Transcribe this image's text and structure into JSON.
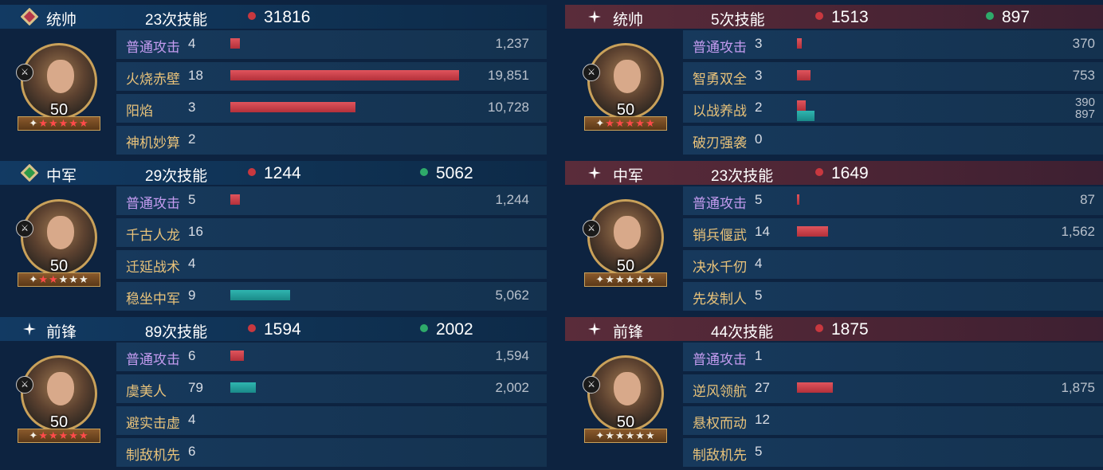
{
  "left": {
    "blocks": [
      {
        "role": "统帅",
        "casts": "23次技能",
        "stats": [
          {
            "color": "red",
            "value": "31816"
          }
        ],
        "level": "50",
        "stars_on": 5,
        "unit_icon": "spear-icon",
        "rows": [
          {
            "skill": "普通攻击",
            "basic": true,
            "count": "4",
            "red": 0.04,
            "teal": 0,
            "dmg": "1,237"
          },
          {
            "skill": "火烧赤壁",
            "basic": false,
            "count": "18",
            "red": 0.99,
            "teal": 0,
            "dmg": "19,851"
          },
          {
            "skill": "阳焰",
            "basic": false,
            "count": "3",
            "red": 0.54,
            "teal": 0,
            "dmg": "10,728"
          },
          {
            "skill": "神机妙算",
            "basic": false,
            "count": "2",
            "red": 0,
            "teal": 0,
            "dmg": ""
          }
        ]
      },
      {
        "role": "中军",
        "casts": "29次技能",
        "stats": [
          {
            "color": "red",
            "value": "1244"
          },
          {
            "color": "green",
            "value": "5062"
          }
        ],
        "level": "50",
        "stars_on": 2,
        "unit_icon": "cavalry-icon",
        "rows": [
          {
            "skill": "普通攻击",
            "basic": true,
            "count": "5",
            "red": 0.04,
            "teal": 0,
            "dmg": "1,244"
          },
          {
            "skill": "千古人龙",
            "basic": false,
            "count": "16",
            "red": 0,
            "teal": 0,
            "dmg": ""
          },
          {
            "skill": "迁延战术",
            "basic": false,
            "count": "4",
            "red": 0,
            "teal": 0,
            "dmg": ""
          },
          {
            "skill": "稳坐中军",
            "basic": false,
            "count": "9",
            "red": 0,
            "teal": 0.26,
            "dmg": "5,062"
          }
        ]
      },
      {
        "role": "前锋",
        "casts": "89次技能",
        "stats": [
          {
            "color": "red",
            "value": "1594"
          },
          {
            "color": "green",
            "value": "2002"
          }
        ],
        "level": "50",
        "stars_on": 5,
        "unit_icon": "horse-icon",
        "rows": [
          {
            "skill": "普通攻击",
            "basic": true,
            "count": "6",
            "red": 0.06,
            "teal": 0,
            "dmg": "1,594"
          },
          {
            "skill": "虞美人",
            "basic": false,
            "count": "79",
            "red": 0,
            "teal": 0.11,
            "dmg": "2,002"
          },
          {
            "skill": "避实击虚",
            "basic": false,
            "count": "4",
            "red": 0,
            "teal": 0,
            "dmg": ""
          },
          {
            "skill": "制敌机先",
            "basic": false,
            "count": "6",
            "red": 0,
            "teal": 0,
            "dmg": ""
          }
        ]
      }
    ]
  },
  "right": {
    "blocks": [
      {
        "role": "统帅",
        "casts": "5次技能",
        "stats": [
          {
            "color": "red",
            "value": "1513"
          },
          {
            "color": "green",
            "value": "897"
          }
        ],
        "level": "50",
        "stars_on": 5,
        "unit_icon": "shield-icon",
        "rows": [
          {
            "skill": "普通攻击",
            "basic": true,
            "count": "3",
            "red": 0.01,
            "teal": 0,
            "dmg": "370"
          },
          {
            "skill": "智勇双全",
            "basic": false,
            "count": "3",
            "red": 0.03,
            "teal": 0,
            "dmg": "753"
          },
          {
            "skill": "以战养战",
            "basic": false,
            "count": "2",
            "red": 0.02,
            "teal": 0.04,
            "dmg": "390",
            "dmg2": "897"
          },
          {
            "skill": "破刃强袭",
            "basic": false,
            "count": "0",
            "red": 0,
            "teal": 0,
            "dmg": ""
          }
        ]
      },
      {
        "role": "中军",
        "casts": "23次技能",
        "stats": [
          {
            "color": "red",
            "value": "1649"
          }
        ],
        "level": "50",
        "stars_on": 0,
        "unit_icon": "shield-icon",
        "rows": [
          {
            "skill": "普通攻击",
            "basic": true,
            "count": "5",
            "red": 0.005,
            "teal": 0,
            "dmg": "87"
          },
          {
            "skill": "销兵偃武",
            "basic": false,
            "count": "14",
            "red": 0.07,
            "teal": 0,
            "dmg": "1,562"
          },
          {
            "skill": "决水千仞",
            "basic": false,
            "count": "4",
            "red": 0,
            "teal": 0,
            "dmg": ""
          },
          {
            "skill": "先发制人",
            "basic": false,
            "count": "5",
            "red": 0,
            "teal": 0,
            "dmg": ""
          }
        ]
      },
      {
        "role": "前锋",
        "casts": "44次技能",
        "stats": [
          {
            "color": "red",
            "value": "1875"
          }
        ],
        "level": "50",
        "stars_on": 0,
        "unit_icon": "spear-icon",
        "rows": [
          {
            "skill": "普通攻击",
            "basic": true,
            "count": "1",
            "red": 0,
            "teal": 0,
            "dmg": ""
          },
          {
            "skill": "逆风领航",
            "basic": false,
            "count": "27",
            "red": 0.08,
            "teal": 0,
            "dmg": "1,875"
          },
          {
            "skill": "悬权而动",
            "basic": false,
            "count": "12",
            "red": 0,
            "teal": 0,
            "dmg": ""
          },
          {
            "skill": "制敌机先",
            "basic": false,
            "count": "5",
            "red": 0,
            "teal": 0,
            "dmg": ""
          }
        ]
      }
    ]
  }
}
